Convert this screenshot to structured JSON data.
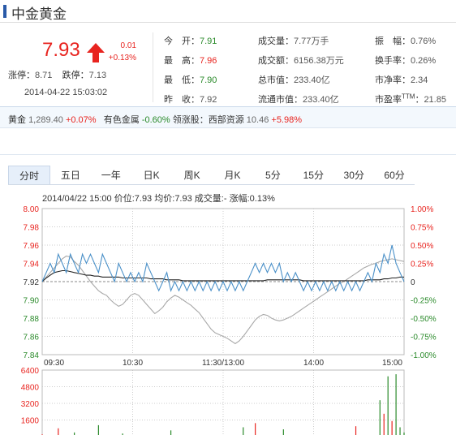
{
  "stock": {
    "name": "中金黄金",
    "price": "7.93",
    "change": "0.01",
    "change_pct": "+0.13%",
    "limit_up_label": "涨停：",
    "limit_up": "8.71",
    "limit_down_label": "跌停：",
    "limit_down": "7.13",
    "datetime": "2014-04-22 15:03:02"
  },
  "stats": [
    {
      "label": "今　开：",
      "value": "7.91",
      "tone": "green"
    },
    {
      "label": "最　高：",
      "value": "7.96",
      "tone": "red"
    },
    {
      "label": "最　低：",
      "value": "7.90",
      "tone": "green"
    },
    {
      "label": "昨　收：",
      "value": "7.92",
      "tone": "normal"
    },
    {
      "label": "成交量：",
      "value": "7.77万手",
      "tone": "normal"
    },
    {
      "label": "成交额：",
      "value": "6156.38万元",
      "tone": "normal"
    },
    {
      "label": "总市值：",
      "value": "233.40亿",
      "tone": "normal"
    },
    {
      "label": "流通市值：",
      "value": "233.40亿",
      "tone": "normal"
    },
    {
      "label": "振　幅：",
      "value": "0.76%",
      "tone": "normal"
    },
    {
      "label": "换手率：",
      "value": "0.26%",
      "tone": "normal"
    },
    {
      "label": "市净率：",
      "value": "2.34",
      "tone": "normal"
    },
    {
      "label": "市盈率",
      "sup": "TTM",
      "suffix": "：",
      "value": "21.85",
      "tone": "normal"
    }
  ],
  "sector": {
    "gold_label": "黄金",
    "gold_value": "1,289.40",
    "gold_change": "+0.07%",
    "metal_label": "有色金属",
    "metal_change": "-0.60%",
    "leader_label": "领涨股：",
    "leader_name": "西部资源",
    "leader_price": "10.46",
    "leader_change": "+5.98%"
  },
  "tabs": [
    "分时",
    "五日",
    "一年",
    "日K",
    "周K",
    "月K",
    "5分",
    "15分",
    "30分",
    "60分"
  ],
  "active_tab": 0,
  "chart_header": {
    "date": "2014/04/22 15:00",
    "price_label": "价位:",
    "price": "7.93",
    "avg_label": "均价:",
    "avg": "7.93",
    "vol_label": "成交量:",
    "vol": "-",
    "amp_label": "涨幅:",
    "amp": "0.13%"
  },
  "colors": {
    "up": "#e8241f",
    "down": "#2a8a2a",
    "price_line": "#4a90c8",
    "avg_line": "#222222",
    "gold_line": "#a8a8a8",
    "grid": "#cccccc"
  },
  "chart_data": {
    "type": "line",
    "price_ticks": [
      "8.00",
      "7.98",
      "7.96",
      "7.94",
      "7.92",
      "7.90",
      "7.88",
      "7.86",
      "7.84"
    ],
    "pct_ticks": [
      "1.00%",
      "0.75%",
      "0.50%",
      "0.25%",
      "0",
      "-0.25%",
      "-0.50%",
      "-0.75%",
      "-1.00%"
    ],
    "time_ticks": [
      "09:30",
      "10:30",
      "11:30/13:00",
      "14:00",
      "15:00"
    ],
    "ylim": [
      7.84,
      8.0
    ],
    "prev_close": 7.92,
    "series": [
      {
        "values": [
          7.92,
          7.93,
          7.94,
          7.93,
          7.95,
          7.94,
          7.93,
          7.95,
          7.94,
          7.93,
          7.95,
          7.94,
          7.95,
          7.94,
          7.93,
          7.95,
          7.94,
          7.93,
          7.92,
          7.94,
          7.93,
          7.92,
          7.93,
          7.92,
          7.93,
          7.92,
          7.94,
          7.93,
          7.92,
          7.91,
          7.92,
          7.93,
          7.91,
          7.92,
          7.91,
          7.92,
          7.91,
          7.92,
          7.91,
          7.92,
          7.91,
          7.92,
          7.91,
          7.92,
          7.91,
          7.92,
          7.91,
          7.92,
          7.91,
          7.92,
          7.91,
          7.92,
          7.93,
          7.94,
          7.93,
          7.94,
          7.93,
          7.94,
          7.93,
          7.94,
          7.92,
          7.93,
          7.92,
          7.93,
          7.92,
          7.91,
          7.92,
          7.91,
          7.92,
          7.91,
          7.92,
          7.91,
          7.92,
          7.91,
          7.92,
          7.91,
          7.92,
          7.91,
          7.92,
          7.91,
          7.92,
          7.93,
          7.92,
          7.94,
          7.93,
          7.95,
          7.94,
          7.96,
          7.94,
          7.93,
          7.92
        ]
      },
      {
        "values": [
          7.92,
          7.924,
          7.927,
          7.93,
          7.931,
          7.932,
          7.932,
          7.931,
          7.93,
          7.929,
          7.928,
          7.927,
          7.927,
          7.926,
          7.926,
          7.925,
          7.925,
          7.925,
          7.925,
          7.925,
          7.924,
          7.924,
          7.924,
          7.924,
          7.924,
          7.924,
          7.924,
          7.923,
          7.923,
          7.923,
          7.923,
          7.922,
          7.922,
          7.922,
          7.922,
          7.921,
          7.921,
          7.921,
          7.921,
          7.921,
          7.921,
          7.921,
          7.921,
          7.921,
          7.921,
          7.921,
          7.921,
          7.921,
          7.921,
          7.921,
          7.921,
          7.921,
          7.921,
          7.921,
          7.921,
          7.921,
          7.922,
          7.922,
          7.922,
          7.922,
          7.922,
          7.922,
          7.922,
          7.922,
          7.922,
          7.921,
          7.921,
          7.921,
          7.921,
          7.921,
          7.921,
          7.921,
          7.921,
          7.921,
          7.921,
          7.921,
          7.921,
          7.921,
          7.921,
          7.921,
          7.921,
          7.922,
          7.922,
          7.922,
          7.922,
          7.923,
          7.923,
          7.924,
          7.924,
          7.925,
          7.925
        ]
      },
      {
        "values": [
          7.92,
          7.925,
          7.93,
          7.935,
          7.94,
          7.945,
          7.948,
          7.947,
          7.942,
          7.938,
          7.932,
          7.926,
          7.92,
          7.915,
          7.91,
          7.907,
          7.905,
          7.9,
          7.896,
          7.893,
          7.895,
          7.9,
          7.905,
          7.907,
          7.905,
          7.9,
          7.895,
          7.89,
          7.885,
          7.888,
          7.892,
          7.898,
          7.902,
          7.905,
          7.903,
          7.9,
          7.897,
          7.894,
          7.89,
          7.886,
          7.88,
          7.874,
          7.868,
          7.864,
          7.862,
          7.86,
          7.858,
          7.855,
          7.852,
          7.855,
          7.86,
          7.866,
          7.872,
          7.878,
          7.882,
          7.884,
          7.883,
          7.88,
          7.878,
          7.877,
          7.878,
          7.88,
          7.882,
          7.885,
          7.888,
          7.891,
          7.894,
          7.897,
          7.9,
          7.903,
          7.906,
          7.909,
          7.912,
          7.915,
          7.918,
          7.92,
          7.923,
          7.926,
          7.929,
          7.932,
          7.935,
          7.937,
          7.939,
          7.94,
          7.942,
          7.943,
          7.944,
          7.945,
          7.944,
          7.943,
          7.942
        ]
      }
    ],
    "volume": {
      "ticks": [
        "6400",
        "4800",
        "3200",
        "1600"
      ],
      "ylim": [
        0,
        6400
      ],
      "values": [
        220,
        60,
        40,
        30,
        800,
        50,
        40,
        30,
        400,
        60,
        40,
        30,
        50,
        40,
        1100,
        60,
        50,
        40,
        30,
        40,
        300,
        50,
        40,
        30,
        60,
        40,
        30,
        50,
        40,
        30,
        50,
        40,
        600,
        50,
        40,
        30,
        50,
        40,
        30,
        50,
        40,
        30,
        50,
        40,
        30,
        50,
        40,
        30,
        50,
        40,
        900,
        50,
        40,
        1300,
        50,
        40,
        30,
        50,
        40,
        30,
        700,
        40,
        30,
        50,
        40,
        30,
        50,
        40,
        30,
        50,
        40,
        30,
        50,
        40,
        30,
        50,
        40,
        30,
        1000,
        40,
        30,
        50,
        40,
        30,
        3500,
        2200,
        5800,
        1500,
        6000,
        900,
        400
      ]
    }
  }
}
